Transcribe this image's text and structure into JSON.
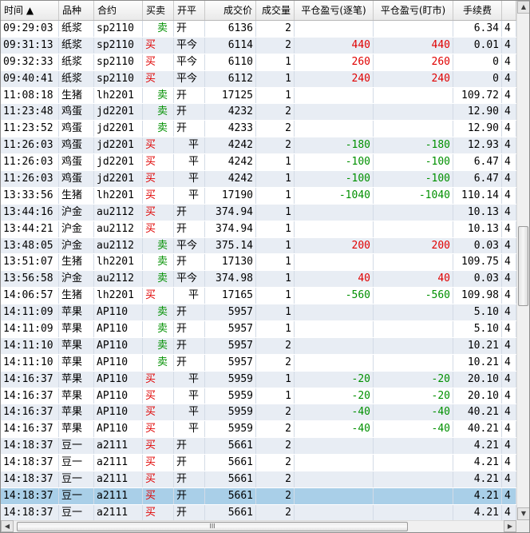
{
  "header": {
    "time": "时间 ▲",
    "variety": "品种",
    "contract": "合约",
    "side": "买卖",
    "openclose": "开平",
    "price": "成交价",
    "volume": "成交量",
    "pnl_trade": "平仓盈亏(逐笔)",
    "pnl_mtm": "平仓盈亏(盯市)",
    "fee": "手续费",
    "extra": "4"
  },
  "rows": [
    {
      "time": "09:29:03",
      "variety": "纸浆",
      "contract": "sp2110",
      "side": "卖",
      "oc": "开",
      "price": "6136",
      "vol": "2",
      "p1": "",
      "p2": "",
      "fee": "6.34",
      "extra": "4"
    },
    {
      "time": "09:31:13",
      "variety": "纸浆",
      "contract": "sp2110",
      "side": "买",
      "oc": "平今",
      "price": "6114",
      "vol": "2",
      "p1": "440",
      "p2": "440",
      "fee": "0.01",
      "extra": "4"
    },
    {
      "time": "09:32:33",
      "variety": "纸浆",
      "contract": "sp2110",
      "side": "买",
      "oc": "平今",
      "price": "6110",
      "vol": "1",
      "p1": "260",
      "p2": "260",
      "fee": "0",
      "extra": "4"
    },
    {
      "time": "09:40:41",
      "variety": "纸浆",
      "contract": "sp2110",
      "side": "买",
      "oc": "平今",
      "price": "6112",
      "vol": "1",
      "p1": "240",
      "p2": "240",
      "fee": "0",
      "extra": "4"
    },
    {
      "time": "11:08:18",
      "variety": "生猪",
      "contract": "lh2201",
      "side": "卖",
      "oc": "开",
      "price": "17125",
      "vol": "1",
      "p1": "",
      "p2": "",
      "fee": "109.72",
      "extra": "4"
    },
    {
      "time": "11:23:48",
      "variety": "鸡蛋",
      "contract": "jd2201",
      "side": "卖",
      "oc": "开",
      "price": "4232",
      "vol": "2",
      "p1": "",
      "p2": "",
      "fee": "12.90",
      "extra": "4"
    },
    {
      "time": "11:23:52",
      "variety": "鸡蛋",
      "contract": "jd2201",
      "side": "卖",
      "oc": "开",
      "price": "4233",
      "vol": "2",
      "p1": "",
      "p2": "",
      "fee": "12.90",
      "extra": "4"
    },
    {
      "time": "11:26:03",
      "variety": "鸡蛋",
      "contract": "jd2201",
      "side": "买",
      "oc": "平",
      "price": "4242",
      "vol": "2",
      "p1": "-180",
      "p2": "-180",
      "fee": "12.93",
      "extra": "4"
    },
    {
      "time": "11:26:03",
      "variety": "鸡蛋",
      "contract": "jd2201",
      "side": "买",
      "oc": "平",
      "price": "4242",
      "vol": "1",
      "p1": "-100",
      "p2": "-100",
      "fee": "6.47",
      "extra": "4"
    },
    {
      "time": "11:26:03",
      "variety": "鸡蛋",
      "contract": "jd2201",
      "side": "买",
      "oc": "平",
      "price": "4242",
      "vol": "1",
      "p1": "-100",
      "p2": "-100",
      "fee": "6.47",
      "extra": "4"
    },
    {
      "time": "13:33:56",
      "variety": "生猪",
      "contract": "lh2201",
      "side": "买",
      "oc": "平",
      "price": "17190",
      "vol": "1",
      "p1": "-1040",
      "p2": "-1040",
      "fee": "110.14",
      "extra": "4"
    },
    {
      "time": "13:44:16",
      "variety": "沪金",
      "contract": "au2112",
      "side": "买",
      "oc": "开",
      "price": "374.94",
      "vol": "1",
      "p1": "",
      "p2": "",
      "fee": "10.13",
      "extra": "4"
    },
    {
      "time": "13:44:21",
      "variety": "沪金",
      "contract": "au2112",
      "side": "买",
      "oc": "开",
      "price": "374.94",
      "vol": "1",
      "p1": "",
      "p2": "",
      "fee": "10.13",
      "extra": "4"
    },
    {
      "time": "13:48:05",
      "variety": "沪金",
      "contract": "au2112",
      "side": "卖",
      "oc": "平今",
      "price": "375.14",
      "vol": "1",
      "p1": "200",
      "p2": "200",
      "fee": "0.03",
      "extra": "4"
    },
    {
      "time": "13:51:07",
      "variety": "生猪",
      "contract": "lh2201",
      "side": "卖",
      "oc": "开",
      "price": "17130",
      "vol": "1",
      "p1": "",
      "p2": "",
      "fee": "109.75",
      "extra": "4"
    },
    {
      "time": "13:56:58",
      "variety": "沪金",
      "contract": "au2112",
      "side": "卖",
      "oc": "平今",
      "price": "374.98",
      "vol": "1",
      "p1": "40",
      "p2": "40",
      "fee": "0.03",
      "extra": "4"
    },
    {
      "time": "14:06:57",
      "variety": "生猪",
      "contract": "lh2201",
      "side": "买",
      "oc": "平",
      "price": "17165",
      "vol": "1",
      "p1": "-560",
      "p2": "-560",
      "fee": "109.98",
      "extra": "4"
    },
    {
      "time": "14:11:09",
      "variety": "苹果",
      "contract": "AP110",
      "side": "卖",
      "oc": "开",
      "price": "5957",
      "vol": "1",
      "p1": "",
      "p2": "",
      "fee": "5.10",
      "extra": "4"
    },
    {
      "time": "14:11:09",
      "variety": "苹果",
      "contract": "AP110",
      "side": "卖",
      "oc": "开",
      "price": "5957",
      "vol": "1",
      "p1": "",
      "p2": "",
      "fee": "5.10",
      "extra": "4"
    },
    {
      "time": "14:11:10",
      "variety": "苹果",
      "contract": "AP110",
      "side": "卖",
      "oc": "开",
      "price": "5957",
      "vol": "2",
      "p1": "",
      "p2": "",
      "fee": "10.21",
      "extra": "4"
    },
    {
      "time": "14:11:10",
      "variety": "苹果",
      "contract": "AP110",
      "side": "卖",
      "oc": "开",
      "price": "5957",
      "vol": "2",
      "p1": "",
      "p2": "",
      "fee": "10.21",
      "extra": "4"
    },
    {
      "time": "14:16:37",
      "variety": "苹果",
      "contract": "AP110",
      "side": "买",
      "oc": "平",
      "price": "5959",
      "vol": "1",
      "p1": "-20",
      "p2": "-20",
      "fee": "20.10",
      "extra": "4"
    },
    {
      "time": "14:16:37",
      "variety": "苹果",
      "contract": "AP110",
      "side": "买",
      "oc": "平",
      "price": "5959",
      "vol": "1",
      "p1": "-20",
      "p2": "-20",
      "fee": "20.10",
      "extra": "4"
    },
    {
      "time": "14:16:37",
      "variety": "苹果",
      "contract": "AP110",
      "side": "买",
      "oc": "平",
      "price": "5959",
      "vol": "2",
      "p1": "-40",
      "p2": "-40",
      "fee": "40.21",
      "extra": "4"
    },
    {
      "time": "14:16:37",
      "variety": "苹果",
      "contract": "AP110",
      "side": "买",
      "oc": "平",
      "price": "5959",
      "vol": "2",
      "p1": "-40",
      "p2": "-40",
      "fee": "40.21",
      "extra": "4"
    },
    {
      "time": "14:18:37",
      "variety": "豆一",
      "contract": "a2111",
      "side": "买",
      "oc": "开",
      "price": "5661",
      "vol": "2",
      "p1": "",
      "p2": "",
      "fee": "4.21",
      "extra": "4"
    },
    {
      "time": "14:18:37",
      "variety": "豆一",
      "contract": "a2111",
      "side": "买",
      "oc": "开",
      "price": "5661",
      "vol": "2",
      "p1": "",
      "p2": "",
      "fee": "4.21",
      "extra": "4"
    },
    {
      "time": "14:18:37",
      "variety": "豆一",
      "contract": "a2111",
      "side": "买",
      "oc": "开",
      "price": "5661",
      "vol": "2",
      "p1": "",
      "p2": "",
      "fee": "4.21",
      "extra": "4"
    },
    {
      "time": "14:18:37",
      "variety": "豆一",
      "contract": "a2111",
      "side": "买",
      "oc": "开",
      "price": "5661",
      "vol": "2",
      "p1": "",
      "p2": "",
      "fee": "4.21",
      "extra": "4",
      "selected": true
    },
    {
      "time": "14:18:37",
      "variety": "豆一",
      "contract": "a2111",
      "side": "买",
      "oc": "开",
      "price": "5661",
      "vol": "2",
      "p1": "",
      "p2": "",
      "fee": "4.21",
      "extra": "4"
    }
  ],
  "colors": {
    "buy": "#e00000",
    "sell": "#009000",
    "selected_row": "#a9cfe8",
    "alt_row": "#e8edf4"
  },
  "scroll": {
    "up_icon": "up-arrow-icon",
    "down_icon": "down-arrow-icon",
    "left_icon": "left-arrow-icon",
    "right_icon": "right-arrow-icon",
    "grip": "III"
  }
}
